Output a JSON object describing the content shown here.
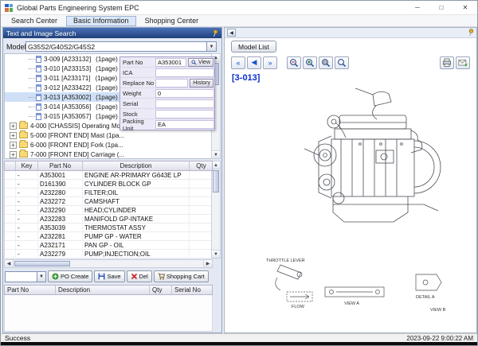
{
  "window": {
    "title": "Global Parts Engineering System EPC"
  },
  "icons": {
    "minimize": "─",
    "maximize": "□",
    "close": "✕",
    "dropdown": "▼",
    "up": "▲",
    "down": "▼",
    "left": "◀",
    "right": "▶",
    "expand": "+",
    "nav_first": "«",
    "nav_prev": "◀",
    "nav_next": "»"
  },
  "colors": {
    "header_blue": "#1f3f7a",
    "accent_blue": "#0a2ecf",
    "selection": "#cfe0f6"
  },
  "tabs": [
    {
      "label": "Search Center",
      "active": false
    },
    {
      "label": "Basic Information",
      "active": true
    },
    {
      "label": "Shopping Center",
      "active": false
    }
  ],
  "left_panel": {
    "header": "Text and Image Search",
    "model_label": "Model",
    "model_value": "G35S2/G40S2/G45S2",
    "tree_items": [
      {
        "type": "page",
        "label": "3-009 [A233132]",
        "pages": "(1page)",
        "selected": false
      },
      {
        "type": "page",
        "label": "3-010 [A233153]",
        "pages": "(1page)",
        "selected": false
      },
      {
        "type": "page",
        "label": "3-011 [A233171]",
        "pages": "(1page)",
        "selected": false
      },
      {
        "type": "page",
        "label": "3-012 [A233422]",
        "pages": "(1page)",
        "selected": false
      },
      {
        "type": "page",
        "label": "3-013 [A353002]",
        "pages": "(1page)",
        "selected": true
      },
      {
        "type": "page",
        "label": "3-014 [A353056]",
        "pages": "(1page)",
        "selected": false
      },
      {
        "type": "page",
        "label": "3-015 [A353057]",
        "pages": "(1page)",
        "selected": false
      },
      {
        "type": "folder",
        "label": "4-000 [CHASSIS] Operating Mo...",
        "pages": "",
        "selected": false
      },
      {
        "type": "folder",
        "label": "5-000 [FRONT END] Mast (1pa...",
        "pages": "",
        "selected": false
      },
      {
        "type": "folder",
        "label": "6-000 [FRONT END] Fork (1pa...",
        "pages": "",
        "selected": false
      },
      {
        "type": "folder",
        "label": "7-000 [FRONT END] Carriage (...",
        "pages": "",
        "selected": false
      }
    ],
    "part_info": [
      {
        "label": "Part No",
        "value": "A353001",
        "button": "View"
      },
      {
        "label": "ICA",
        "value": ""
      },
      {
        "label": "Replace No",
        "value": "",
        "button": "History"
      },
      {
        "label": "Weight",
        "value": "0"
      },
      {
        "label": "Serial",
        "value": ""
      },
      {
        "label": "Stock",
        "value": ""
      },
      {
        "label": "Packing Unit",
        "value": "EA"
      }
    ],
    "parts_table": {
      "columns": [
        "",
        "Key",
        "Part No",
        "Description",
        "Qty"
      ],
      "rows": [
        {
          "key": "-",
          "part_no": "A353001",
          "description": "ENGINE AR-PRIMARY G643E LP",
          "qty": ""
        },
        {
          "key": "-",
          "part_no": "D161390",
          "description": "CYLINDER BLOCK GP",
          "qty": ""
        },
        {
          "key": "-",
          "part_no": "A232280",
          "description": "FILTER;OIL",
          "qty": ""
        },
        {
          "key": "-",
          "part_no": "A232272",
          "description": "CAMSHAFT",
          "qty": ""
        },
        {
          "key": "-",
          "part_no": "A232290",
          "description": "HEAD;CYLINDER",
          "qty": ""
        },
        {
          "key": "-",
          "part_no": "A232283",
          "description": "MANIFOLD GP-INTAKE",
          "qty": ""
        },
        {
          "key": "-",
          "part_no": "A353039",
          "description": "THERMOSTAT ASSY",
          "qty": ""
        },
        {
          "key": "-",
          "part_no": "A232281",
          "description": "PUMP GP - WATER",
          "qty": ""
        },
        {
          "key": "-",
          "part_no": "A232171",
          "description": "PAN GP - OIL",
          "qty": ""
        },
        {
          "key": "-",
          "part_no": "A232279",
          "description": "PUMP;INJECTION;OIL",
          "qty": ""
        }
      ]
    },
    "actions": {
      "po_create": "PO Create",
      "save": "Save",
      "del": "Del",
      "shopping_cart": "Shopping Cart"
    },
    "bottom_table": {
      "columns": [
        "Part No",
        "Description",
        "Qty",
        "Serial No"
      ]
    }
  },
  "right_panel": {
    "model_list_button": "Model List",
    "page_ref": "[3-013]",
    "diagram_labels": {
      "throttle": "THROTTLE LEVER",
      "flow": "FLOW",
      "view_a": "VIEW A",
      "detail_a": "DETAIL A",
      "view_b": "VIEW B"
    }
  },
  "status_bar": {
    "message": "Success",
    "time": "2023-09-22 9:00:22 AM"
  }
}
